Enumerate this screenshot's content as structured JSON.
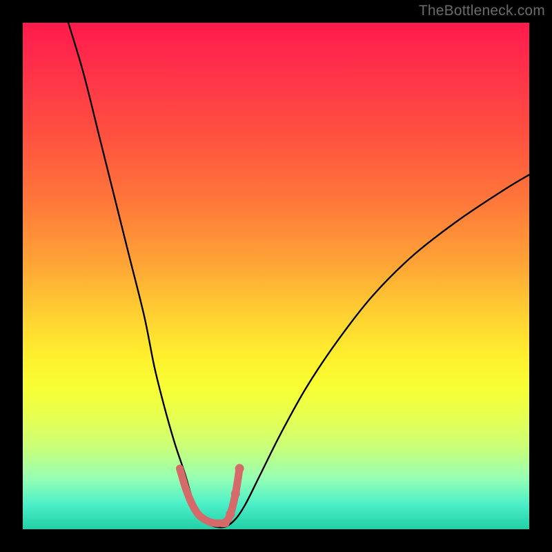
{
  "watermark": "TheBottleneck.com",
  "colors": {
    "frame": "#000000",
    "curve": "#000000",
    "marker": "#d46a6a",
    "gradient_top": "#ff1a4d",
    "gradient_bottom": "#22cfa6"
  },
  "chart_data": {
    "type": "line",
    "title": "",
    "xlabel": "",
    "ylabel": "",
    "xlim": [
      0,
      100
    ],
    "ylim": [
      0,
      100
    ],
    "grid": false,
    "legend": false,
    "note": "Values are approximate, read off pixel positions. Y is bottleneck % where 0 = bottom (green, no bottleneck) and 100 = top (red, max bottleneck).",
    "series": [
      {
        "name": "bottleneck-curve-left",
        "x": [
          9,
          12,
          15,
          18,
          21,
          24,
          26,
          28,
          30,
          32,
          33.5,
          35,
          36.5,
          38
        ],
        "values": [
          100,
          90,
          78,
          66,
          54,
          42,
          32,
          24,
          17,
          11,
          6,
          3,
          1.2,
          0.5
        ]
      },
      {
        "name": "bottleneck-curve-right",
        "x": [
          40,
          42,
          44,
          47,
          51,
          56,
          62,
          69,
          77,
          86,
          95,
          100
        ],
        "values": [
          0.5,
          2,
          5,
          11,
          19,
          28,
          37,
          46,
          54,
          61,
          67,
          70
        ]
      },
      {
        "name": "optimal-marker-L",
        "x": [
          31,
          32.2,
          33.4,
          34.6,
          35.8,
          37,
          38,
          39,
          40,
          41,
          42,
          42.8
        ],
        "values": [
          12,
          8,
          5,
          3,
          2,
          1.4,
          1.2,
          1.2,
          1.3,
          3,
          7,
          12
        ]
      }
    ]
  }
}
